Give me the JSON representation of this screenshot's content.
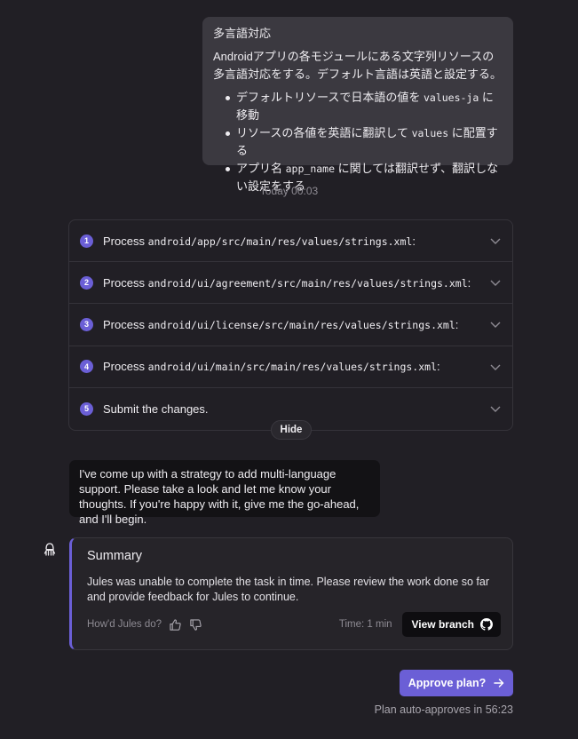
{
  "user_message": {
    "title": "多言語対応",
    "body": "Androidアプリの各モジュールにある文字列リソースの多言語対応をする。デフォルト言語は英語と設定する。",
    "bullets": [
      {
        "pre": "デフォルトリソースで日本語の値を ",
        "code": "values-ja",
        "post": " に移動"
      },
      {
        "pre": "リソースの各値を英語に翻訳して ",
        "code": "values",
        "post": " に配置する"
      },
      {
        "pre": "アプリ名 ",
        "code": "app_name",
        "post": " に関しては翻訳せず、翻訳しない設定をする"
      }
    ]
  },
  "timestamp": "Today 00:03",
  "plan": {
    "steps": [
      {
        "num": "1",
        "label": "Process",
        "path": "android/app/src/main/res/values/strings.xml",
        "suffix": ":"
      },
      {
        "num": "2",
        "label": "Process",
        "path": "android/ui/agreement/src/main/res/values/strings.xml",
        "suffix": ":"
      },
      {
        "num": "3",
        "label": "Process",
        "path": "android/ui/license/src/main/res/values/strings.xml",
        "suffix": ":"
      },
      {
        "num": "4",
        "label": "Process",
        "path": "android/ui/main/src/main/res/values/strings.xml",
        "suffix": ":"
      },
      {
        "num": "5",
        "label": "Submit the changes.",
        "path": "",
        "suffix": ""
      }
    ],
    "hide_label": "Hide"
  },
  "agent_message": "I've come up with a strategy to add multi-language support. Please take a look and let me know your thoughts. If you're happy with it, give me the go-ahead, and I'll begin.",
  "summary": {
    "title": "Summary",
    "body": "Jules was unable to complete the task in time. Please review the work done so far and provide feedback for Jules to continue.",
    "feedback_prompt": "How'd Jules do?",
    "time": "Time: 1 min",
    "view_branch": "View branch"
  },
  "approve": {
    "label": "Approve plan?",
    "countdown": "Plan auto-approves in 56:23"
  },
  "colors": {
    "background": "#211f25",
    "accent": "#6b5fd6",
    "bubble": "#3b3940"
  }
}
